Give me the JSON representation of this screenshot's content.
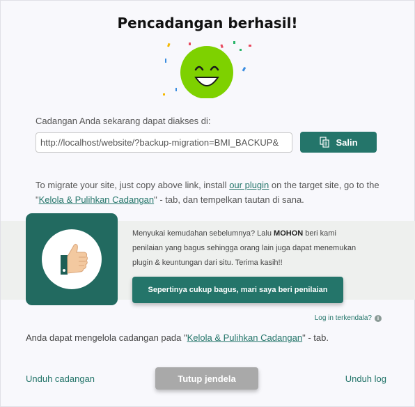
{
  "dialog": {
    "title": "Pencadangan berhasil!",
    "access_label": "Cadangan Anda sekarang dapat diakses di:",
    "backup_url": "http://localhost/website/?backup-migration=BMI_BACKUP&",
    "copy_label": "Salin",
    "migrate": {
      "part1": "To migrate your site, just copy above link, install ",
      "plugin_link": "our plugin",
      "part2": " on the target site, go to the \"",
      "manage_link": "Kelola & Pulihkan Cadangan",
      "part3": "\" - tab, dan tempelkan tautan di sana."
    },
    "rating": {
      "line_pre": "Menyukai kemudahan sebelumnya? Lalu ",
      "bold": "MOHON",
      "line_post": " beri kami penilaian yang bagus sehingga orang lain juga dapat menemukan plugin & keuntungan dari situ. Terima kasih!!",
      "button": "Sepertinya cukup bagus, mari saya beri penilaian"
    },
    "trouble_link": "Log in terkendala?",
    "manage": {
      "pre": "Anda dapat mengelola cadangan pada \"",
      "link": "Kelola & Pulihkan Cadangan",
      "post": "\" - tab."
    },
    "footer": {
      "download_backup": "Unduh cadangan",
      "close": "Tutup jendela",
      "download_log": "Unduh log"
    }
  },
  "colors": {
    "accent": "#24756a",
    "smiley": "#7ed100",
    "close_button": "#a9a9a9"
  },
  "icons": {
    "copy": "copy-icon",
    "thumb": "thumbs-up-icon",
    "info": "info-icon",
    "smiley": "smiley-face-icon"
  }
}
